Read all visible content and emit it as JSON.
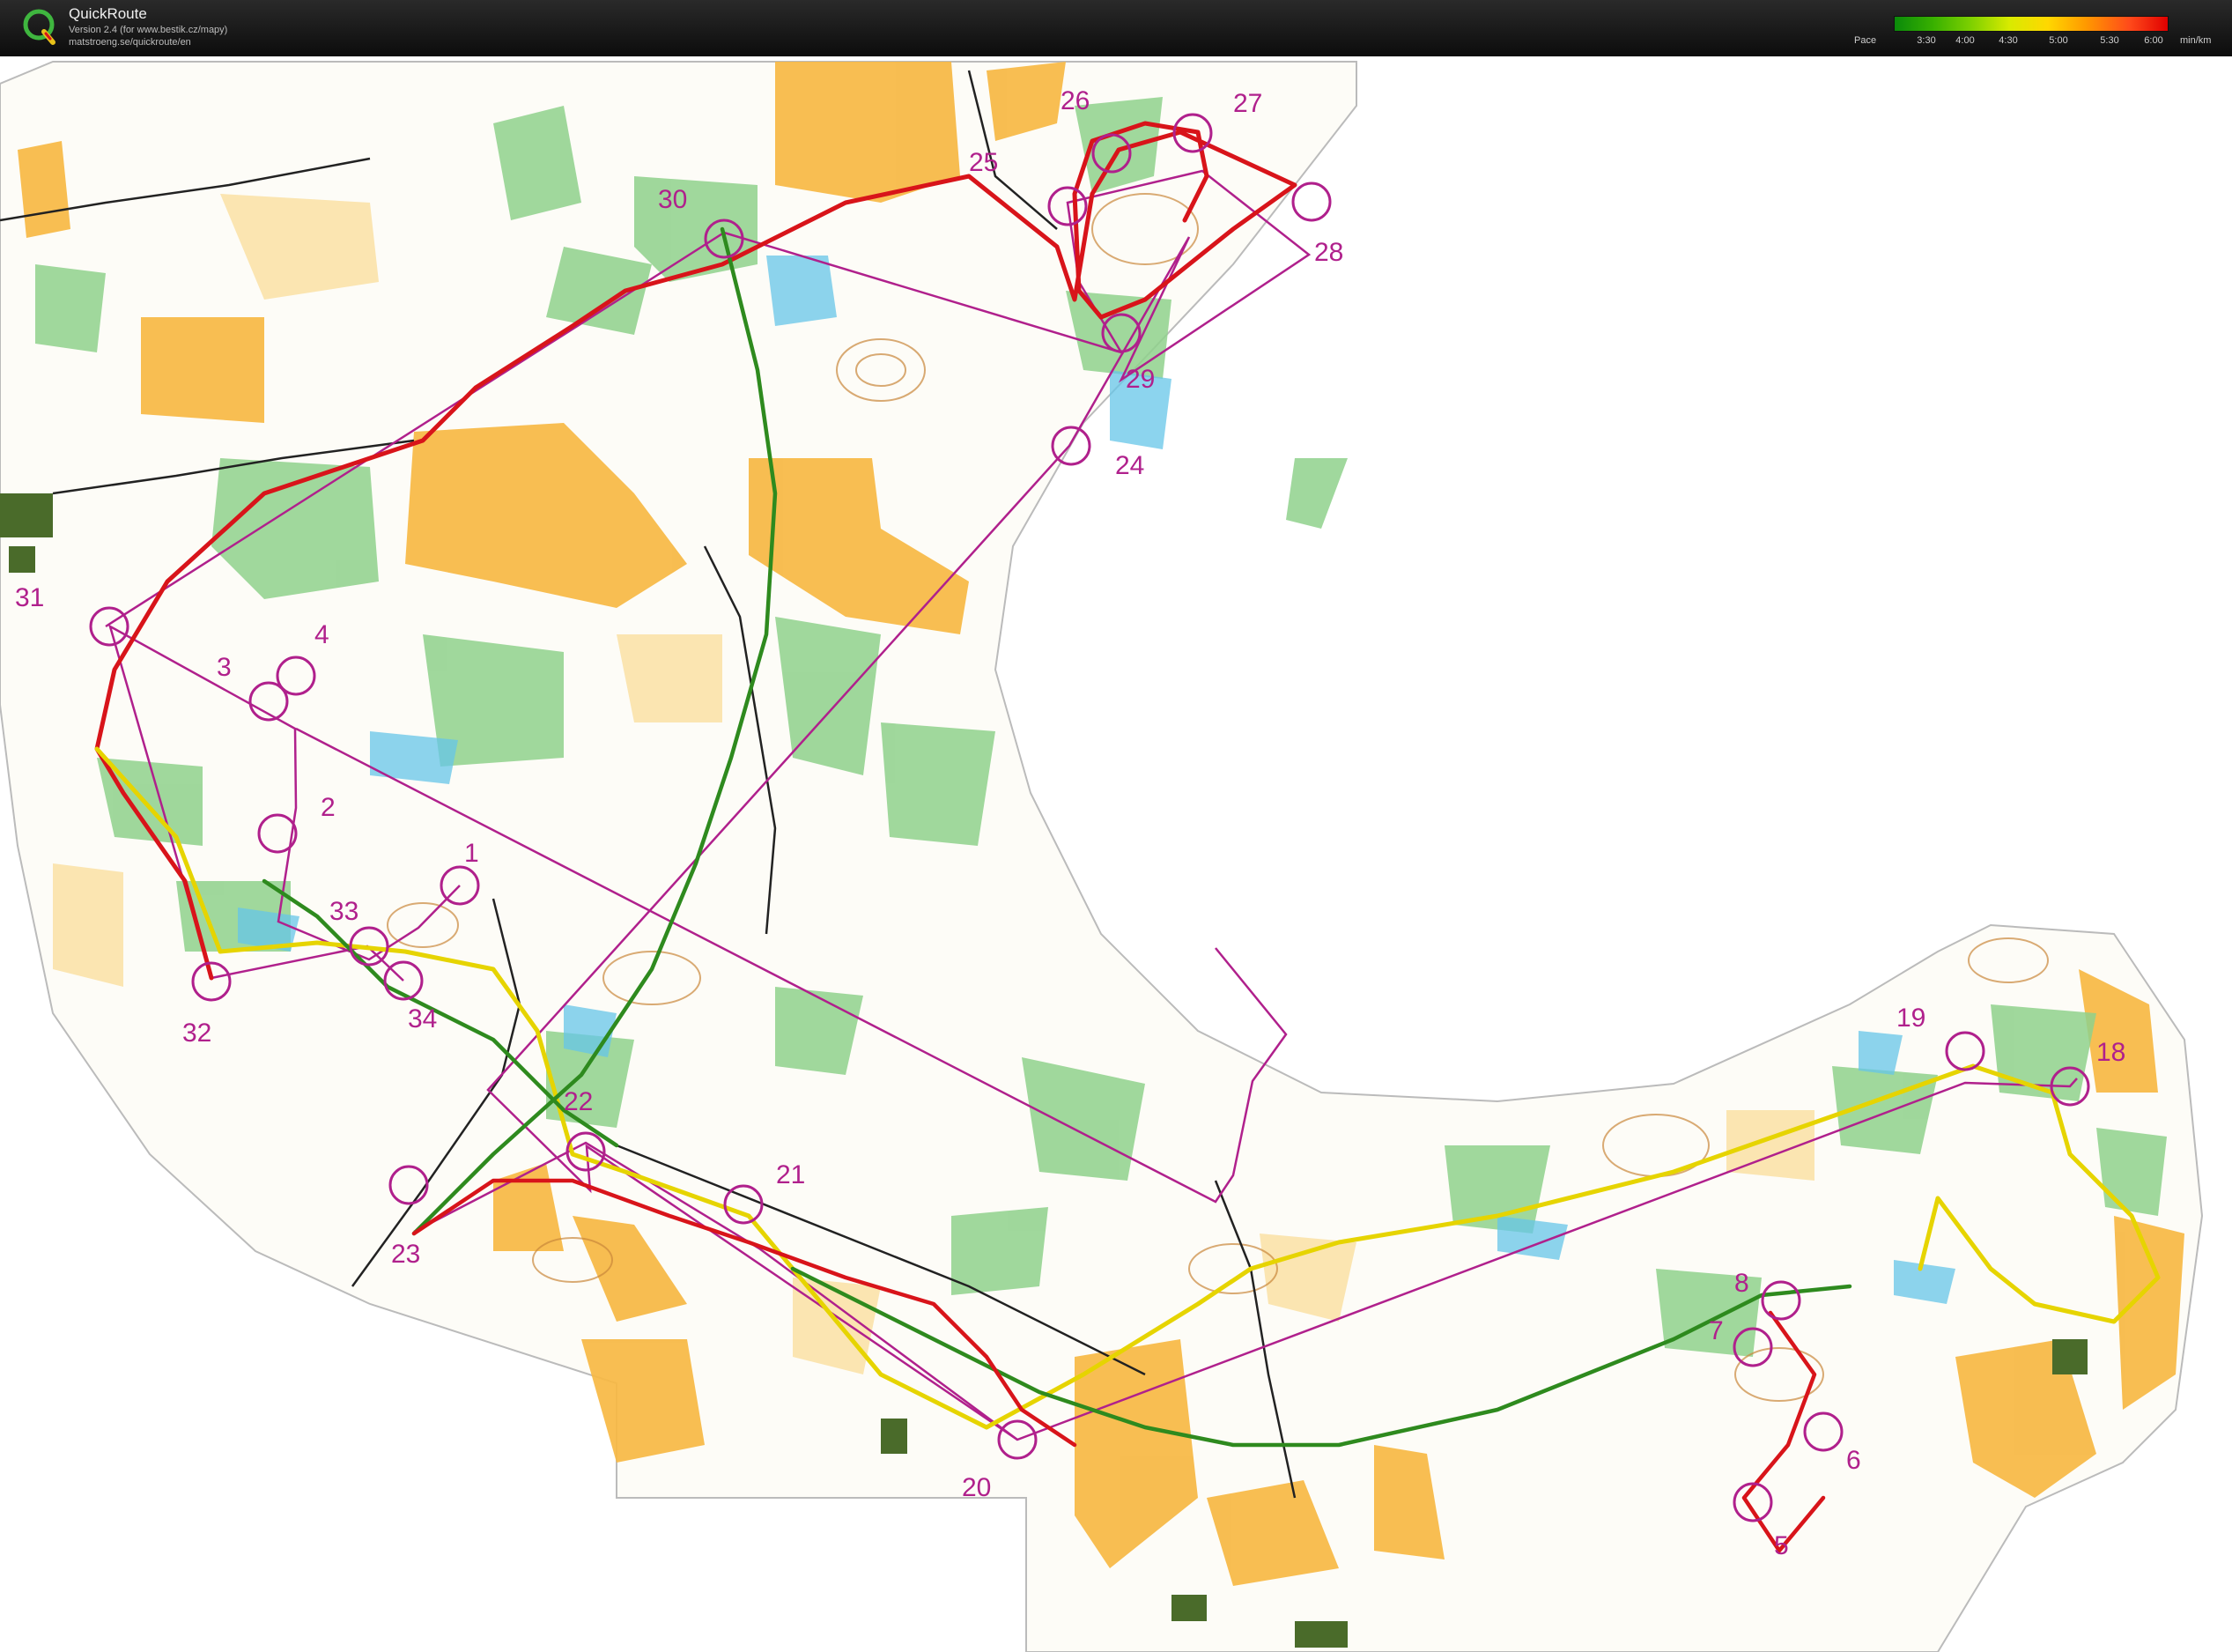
{
  "app": {
    "title": "QuickRoute",
    "version_line": "Version 2.4  (for www.bestik.cz/mapy)",
    "url_line": "matstroeng.se/quickroute/en"
  },
  "pace_legend": {
    "label": "Pace",
    "ticks": [
      "3:30",
      "4:00",
      "4:30",
      "5:00",
      "5:30",
      "6:00"
    ],
    "unit": "min/km",
    "colors": [
      "#0a8a0a",
      "#7ed000",
      "#ffd800",
      "#ff9900",
      "#e00000"
    ]
  },
  "map": {
    "colors": {
      "open_land": "#f7b843",
      "rough_open": "#fbe2a8",
      "forest_green": "#8fd18c",
      "marsh_blue": "#66c6e8",
      "contour_brown": "#c9873a",
      "course_purple": "#b0208c",
      "route_red": "#d8141a",
      "route_yellow": "#e6d400",
      "route_green": "#2e8a1e"
    },
    "controls": [
      {
        "number": "1"
      },
      {
        "number": "2"
      },
      {
        "number": "3"
      },
      {
        "number": "4"
      },
      {
        "number": "5"
      },
      {
        "number": "6"
      },
      {
        "number": "7"
      },
      {
        "number": "8"
      },
      {
        "number": "18"
      },
      {
        "number": "19"
      },
      {
        "number": "20"
      },
      {
        "number": "21"
      },
      {
        "number": "22"
      },
      {
        "number": "23"
      },
      {
        "number": "24"
      },
      {
        "number": "25"
      },
      {
        "number": "26"
      },
      {
        "number": "27"
      },
      {
        "number": "28"
      },
      {
        "number": "29"
      },
      {
        "number": "30"
      },
      {
        "number": "31"
      },
      {
        "number": "32"
      },
      {
        "number": "33"
      },
      {
        "number": "34"
      }
    ]
  }
}
